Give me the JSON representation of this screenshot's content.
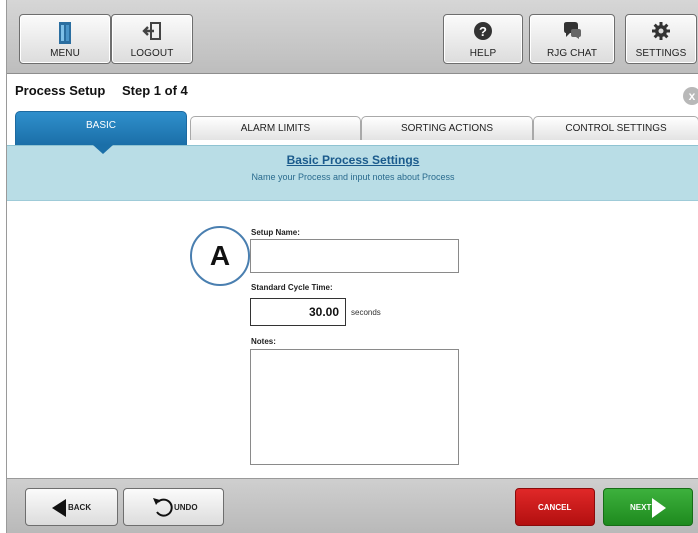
{
  "toolbar": {
    "menu": "MENU",
    "logout": "LOGOUT",
    "help": "HELP",
    "chat": "RJG CHAT",
    "settings": "SETTINGS"
  },
  "header": {
    "title": "Process Setup",
    "step": "Step 1 of 4",
    "close_glyph": "x"
  },
  "tabs": [
    {
      "label": "BASIC",
      "active": true
    },
    {
      "label": "ALARM LIMITS",
      "active": false
    },
    {
      "label": "SORTING ACTIONS",
      "active": false
    },
    {
      "label": "CONTROL SETTINGS",
      "active": false
    }
  ],
  "band": {
    "title": "Basic Process Settings",
    "subtitle": "Name your Process and input notes about Process"
  },
  "form": {
    "setup_name_label": "Setup Name:",
    "setup_name_value": "",
    "cycle_time_label": "Standard Cycle Time:",
    "cycle_time_value": "30.00",
    "cycle_time_unit": "seconds",
    "notes_label": "Notes:",
    "notes_value": "",
    "callout": "A"
  },
  "footer": {
    "back": "BACK",
    "undo": "UNDO",
    "cancel": "CANCEL",
    "next": "NEXT"
  },
  "colors": {
    "tab_active": "#1b6fa8",
    "band": "#b9dde6",
    "cancel": "#c81a1a",
    "next": "#2a9a2a"
  },
  "icons": [
    "menu-icon",
    "logout-icon",
    "help-icon",
    "chat-icon",
    "gear-icon",
    "close-icon",
    "back-arrow-icon",
    "undo-icon",
    "next-arrow-icon"
  ]
}
